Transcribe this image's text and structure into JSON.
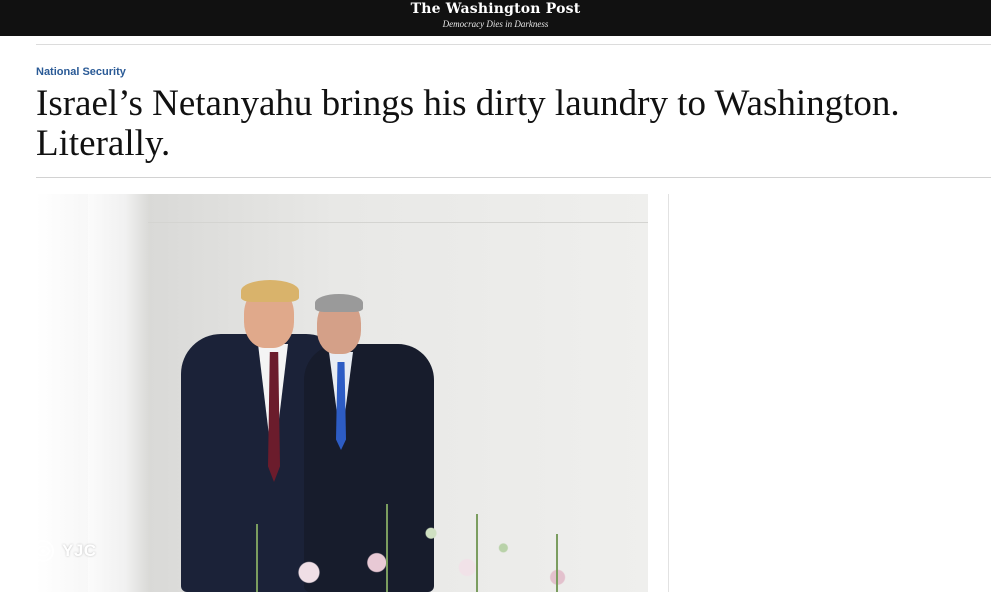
{
  "masthead": {
    "brand": "The Washington Post",
    "tagline": "Democracy Dies in Darkness"
  },
  "article": {
    "kicker": "National Security",
    "headline": "Israel’s Netanyahu brings his dirty laundry to Washington. Literally."
  },
  "watermark": {
    "text": "YJC"
  },
  "colors": {
    "masthead_bg": "#111111",
    "kicker": "#2a5a96",
    "headline": "#111111"
  }
}
